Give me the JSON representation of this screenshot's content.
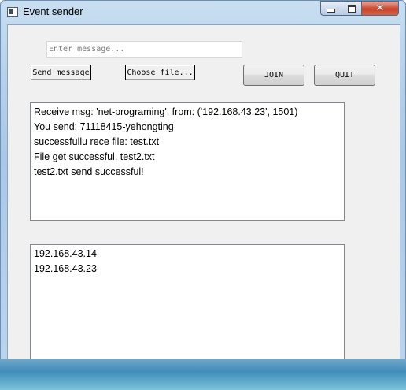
{
  "window": {
    "title": "Event sender"
  },
  "controls": {
    "message_placeholder": "Enter message...",
    "message_value": "",
    "send_label": "Send message",
    "choose_label": "Choose file...",
    "join_label": "JOIN",
    "quit_label": "QUIT"
  },
  "log": {
    "lines": [
      "Receive msg: 'net-programing', from: ('192.168.43.23', 1501)",
      "You send: 71118415-yehongting",
      "successfullu rece file: test.txt",
      "File get successful. test2.txt",
      "test2.txt send successful!"
    ]
  },
  "hosts": {
    "lines": [
      "192.168.43.14",
      "192.168.43.23"
    ]
  },
  "icons": {
    "app": "window-app-icon",
    "minimize": "minimize-icon",
    "maximize": "maximize-icon",
    "close": "close-icon"
  },
  "colors": {
    "close_button": "#c8452c",
    "client_bg": "#f0f0f0",
    "taskbar": "#3f8dbb"
  }
}
